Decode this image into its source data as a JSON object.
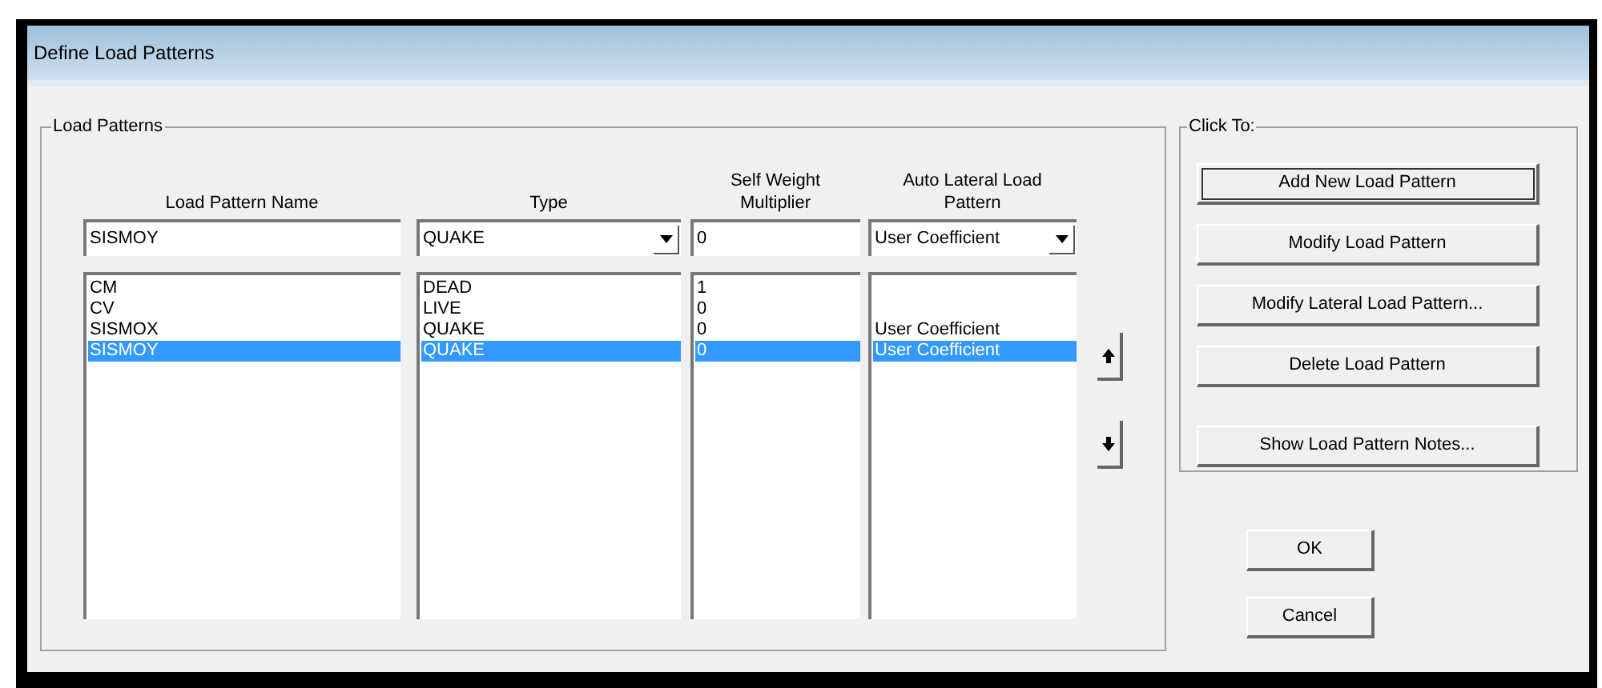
{
  "window": {
    "title": "Define Load Patterns"
  },
  "load_patterns": {
    "legend": "Load Patterns",
    "columns": [
      "Load Pattern Name",
      "Type",
      "Self Weight Multiplier",
      "Auto Lateral Load Pattern"
    ],
    "editor": {
      "name": "SISMOY",
      "type": "QUAKE",
      "multiplier": "0",
      "auto_lateral": "User Coefficient"
    },
    "rows": [
      {
        "name": "CM",
        "type": "DEAD",
        "multiplier": "1",
        "selected": false
      },
      {
        "name": "CV",
        "type": "LIVE",
        "multiplier": "0",
        "selected": false
      },
      {
        "name": "SISMOX",
        "type": "QUAKE",
        "multiplier": "0",
        "auto_lateral": "User Coefficient",
        "selected": false
      },
      {
        "name": "SISMOY",
        "type": "QUAKE",
        "multiplier": "0",
        "auto_lateral": "User Coefficient",
        "selected": true
      }
    ]
  },
  "click_to": {
    "legend": "Click To:",
    "buttons": [
      {
        "label": "Add New Load Pattern",
        "focused": true
      },
      {
        "label": "Modify Load Pattern",
        "focused": false
      },
      {
        "label": "Modify Lateral Load Pattern...",
        "focused": false
      },
      {
        "label": "Delete Load Pattern",
        "focused": false
      },
      {
        "label": "Show Load Pattern Notes...",
        "focused": false
      }
    ]
  },
  "buttons": [
    "OK",
    "Cancel"
  ]
}
